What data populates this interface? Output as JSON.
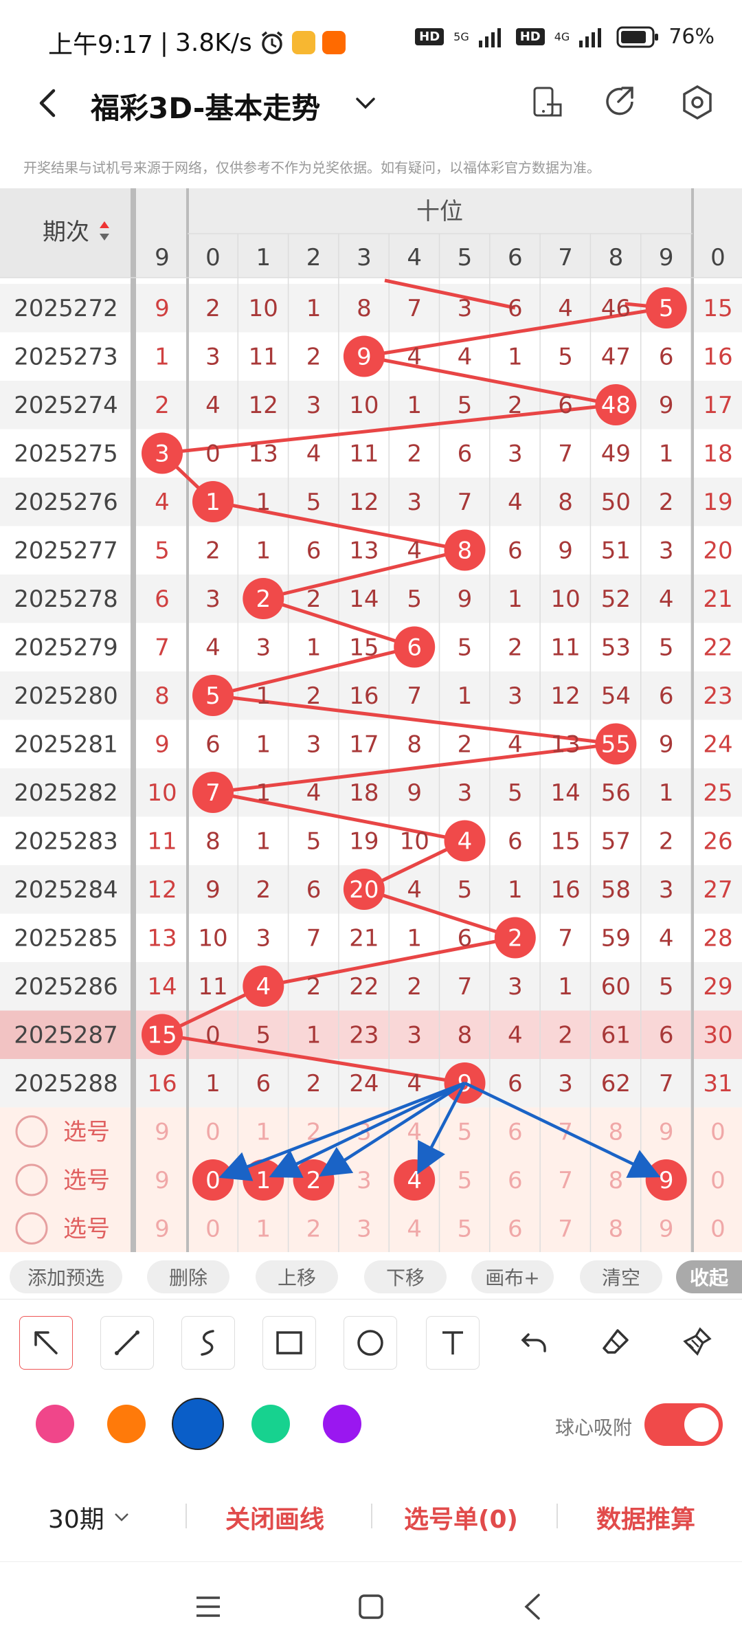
{
  "status_bar": {
    "time": "上午9:17",
    "speed": "3.8K/s",
    "network_labels": [
      "HD",
      "5G",
      "HD",
      "4G"
    ],
    "battery": "76%"
  },
  "header": {
    "title": "福彩3D-基本走势"
  },
  "notice": "开奖结果与试机号来源于网络，仅供参考不作为兑奖依据。如有疑问，以福体彩官方数据为准。",
  "grid": {
    "period_header": "期次",
    "section_label": "十位",
    "columns": [
      "9",
      "0",
      "1",
      "2",
      "3",
      "4",
      "5",
      "6",
      "7",
      "8",
      "9",
      "0"
    ],
    "rows": [
      {
        "period": "2025272",
        "cells": [
          "9",
          "2",
          "10",
          "1",
          "8",
          "7",
          "3",
          "6",
          "4",
          "46",
          "5",
          "15"
        ],
        "hit": 10
      },
      {
        "period": "2025273",
        "cells": [
          "1",
          "3",
          "11",
          "2",
          "9",
          "4",
          "4",
          "1",
          "5",
          "47",
          "6",
          "16"
        ],
        "hit": 4
      },
      {
        "period": "2025274",
        "cells": [
          "2",
          "4",
          "12",
          "3",
          "10",
          "1",
          "5",
          "2",
          "6",
          "48",
          "9",
          "17"
        ],
        "hit": 9
      },
      {
        "period": "2025275",
        "cells": [
          "3",
          "0",
          "13",
          "4",
          "11",
          "2",
          "6",
          "3",
          "7",
          "49",
          "1",
          "18"
        ],
        "hit": 0
      },
      {
        "period": "2025276",
        "cells": [
          "4",
          "1",
          "1",
          "5",
          "12",
          "3",
          "7",
          "4",
          "8",
          "50",
          "2",
          "19"
        ],
        "hit": 1
      },
      {
        "period": "2025277",
        "cells": [
          "5",
          "2",
          "1",
          "6",
          "13",
          "4",
          "8",
          "6",
          "9",
          "51",
          "3",
          "20"
        ],
        "hit": 6
      },
      {
        "period": "2025278",
        "cells": [
          "6",
          "3",
          "2",
          "2",
          "14",
          "5",
          "9",
          "1",
          "10",
          "52",
          "4",
          "21"
        ],
        "hit": 2
      },
      {
        "period": "2025279",
        "cells": [
          "7",
          "4",
          "3",
          "1",
          "15",
          "6",
          "5",
          "2",
          "11",
          "53",
          "5",
          "22"
        ],
        "hit": 5
      },
      {
        "period": "2025280",
        "cells": [
          "8",
          "5",
          "1",
          "2",
          "16",
          "7",
          "1",
          "3",
          "12",
          "54",
          "6",
          "23"
        ],
        "hit": 1
      },
      {
        "period": "2025281",
        "cells": [
          "9",
          "6",
          "1",
          "3",
          "17",
          "8",
          "2",
          "4",
          "13",
          "55",
          "9",
          "24"
        ],
        "hit": 9
      },
      {
        "period": "2025282",
        "cells": [
          "10",
          "7",
          "1",
          "4",
          "18",
          "9",
          "3",
          "5",
          "14",
          "56",
          "1",
          "25"
        ],
        "hit": 1
      },
      {
        "period": "2025283",
        "cells": [
          "11",
          "8",
          "1",
          "5",
          "19",
          "10",
          "4",
          "6",
          "15",
          "57",
          "2",
          "26"
        ],
        "hit": 6
      },
      {
        "period": "2025284",
        "cells": [
          "12",
          "9",
          "2",
          "6",
          "20",
          "4",
          "5",
          "1",
          "16",
          "58",
          "3",
          "27"
        ],
        "hit": 4
      },
      {
        "period": "2025285",
        "cells": [
          "13",
          "10",
          "3",
          "7",
          "21",
          "1",
          "6",
          "2",
          "7",
          "59",
          "4",
          "28"
        ],
        "hit": 7
      },
      {
        "period": "2025286",
        "cells": [
          "14",
          "11",
          "4",
          "2",
          "22",
          "2",
          "7",
          "3",
          "1",
          "60",
          "5",
          "29"
        ],
        "hit": 2
      },
      {
        "period": "2025287",
        "cells": [
          "15",
          "0",
          "5",
          "1",
          "23",
          "3",
          "8",
          "4",
          "2",
          "61",
          "6",
          "30"
        ],
        "hit": 0
      },
      {
        "period": "2025288",
        "cells": [
          "16",
          "1",
          "6",
          "2",
          "24",
          "4",
          "9",
          "6",
          "3",
          "62",
          "7",
          "31"
        ],
        "hit": 6
      }
    ],
    "pick_label": "选号",
    "pick_rows": [
      {
        "cells": [
          "9",
          "0",
          "1",
          "2",
          "3",
          "4",
          "5",
          "6",
          "7",
          "8",
          "9",
          "0"
        ],
        "selected": []
      },
      {
        "cells": [
          "9",
          "0",
          "1",
          "2",
          "3",
          "4",
          "5",
          "6",
          "7",
          "8",
          "9",
          "0"
        ],
        "selected": [
          0,
          1,
          2,
          4,
          9
        ]
      },
      {
        "cells": [
          "9",
          "0",
          "1",
          "2",
          "3",
          "4",
          "5",
          "6",
          "7",
          "8",
          "9",
          "0"
        ],
        "selected": []
      }
    ]
  },
  "actions": [
    "添加预选",
    "删除",
    "上移",
    "下移",
    "画布+",
    "清空",
    "收起"
  ],
  "tools": [
    "arrow-tool",
    "line-tool",
    "curve-tool",
    "rectangle-tool",
    "circle-tool",
    "text-tool",
    "undo-tool",
    "eraser-tool",
    "clear-all-tool"
  ],
  "colors": {
    "palette": [
      "#f0468a",
      "#ff7a0a",
      "#0a5ec8",
      "#17d28f",
      "#9a17f0"
    ],
    "selected_index": 2,
    "ball": "#f04a4a",
    "line": "#e84545",
    "arrow": "#1a63c6"
  },
  "snap_label": "球心吸附",
  "bottom": {
    "period": "30期",
    "close_lines": "关闭画线",
    "pick_list": "选号单(0)",
    "data_calc": "数据推算"
  }
}
